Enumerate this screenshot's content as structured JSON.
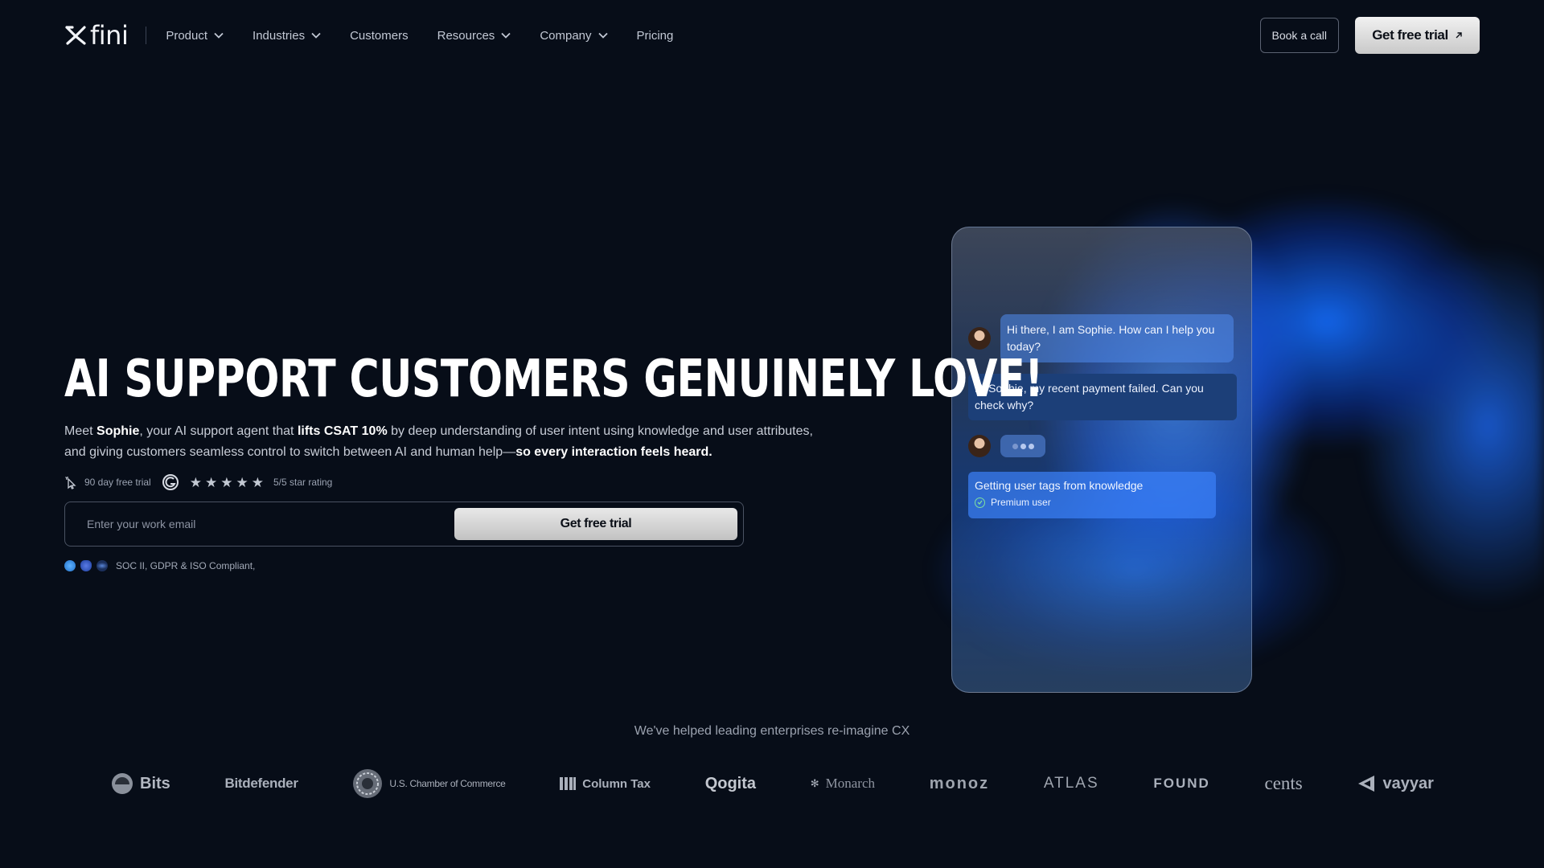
{
  "nav": {
    "logo_text": "fini",
    "items": [
      {
        "label": "Product",
        "has_dropdown": true
      },
      {
        "label": "Industries",
        "has_dropdown": true
      },
      {
        "label": "Customers",
        "has_dropdown": false
      },
      {
        "label": "Resources",
        "has_dropdown": true
      },
      {
        "label": "Company",
        "has_dropdown": true
      },
      {
        "label": "Pricing",
        "has_dropdown": false
      }
    ],
    "book_call": "Book a call",
    "trial": "Get free trial"
  },
  "hero": {
    "headline": "AI SUPPORT CUSTOMERS GENUINELY LOVE!",
    "sub": {
      "p1": "Meet ",
      "name": "Sophie",
      "p2": ", your AI support agent that ",
      "bold1": "lifts CSAT 10%",
      "p3": " by deep understanding of user intent using knowledge and user attributes, and giving customers seamless control to switch between AI and human help—",
      "bold2": "so every interaction feels heard."
    },
    "trial_days": "90 day free trial",
    "rating_text": "5/5 star rating",
    "rating": 5,
    "email_placeholder": "Enter your work email",
    "cta": "Get free trial",
    "compliance": "SOC II, GDPR & ISO Compliant,"
  },
  "chat": {
    "ai_greeting": "Hi there, I am Sophie. How can I help you today?",
    "user_message": "Hi Sophie, my recent payment failed. Can you check why?",
    "tag_title": "Getting user tags from knowledge",
    "tag_value": "Premium user"
  },
  "clients": {
    "heading": "We've helped leading enterprises re-imagine CX",
    "logos": [
      "Bits",
      "Bitdefender",
      "U.S. Chamber of Commerce",
      "Column Tax",
      "Qogita",
      "Monarch",
      "monoz",
      "ATLAS",
      "FOUND",
      "cents",
      "vayyar"
    ]
  },
  "colors": {
    "background": "#070d18",
    "accent_blue": "#2f7bff",
    "user_bubble": "#1c3f78"
  }
}
